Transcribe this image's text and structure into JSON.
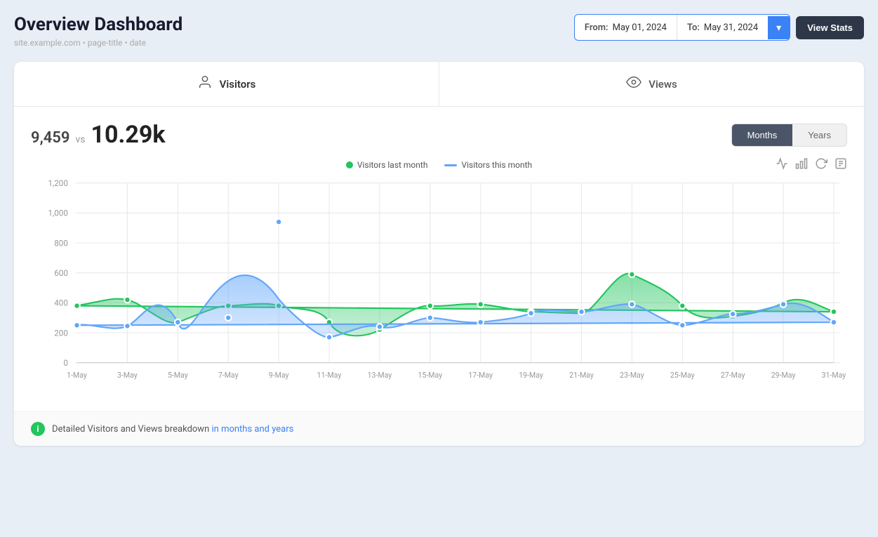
{
  "header": {
    "title": "Overview Dashboard",
    "subtitle": "site.example.com • page-title • date",
    "from_label": "From:",
    "from_date": "May 01, 2024",
    "to_label": "To:",
    "to_date": "May 31, 2024",
    "dropdown_icon": "▾",
    "view_stats_label": "View Stats"
  },
  "tabs": [
    {
      "label": "Visitors",
      "icon": "person",
      "active": true
    },
    {
      "label": "Views",
      "icon": "eye",
      "active": false
    }
  ],
  "stats": {
    "previous": "9,459",
    "vs_label": "vs",
    "current": "10.29k"
  },
  "toggle": {
    "months_label": "Months",
    "years_label": "Years"
  },
  "legend": [
    {
      "label": "Visitors last month",
      "color": "#22c55e",
      "type": "dot"
    },
    {
      "label": "Visitors this month",
      "color": "#60a5fa",
      "type": "square"
    }
  ],
  "chart": {
    "y_labels": [
      "1,200",
      "1,000",
      "800",
      "600",
      "400",
      "200",
      "0"
    ],
    "x_labels": [
      "1-May",
      "3-May",
      "5-May",
      "7-May",
      "9-May",
      "11-May",
      "13-May",
      "15-May",
      "17-May",
      "19-May",
      "21-May",
      "23-May",
      "25-May",
      "27-May",
      "29-May",
      "31-May"
    ]
  },
  "chart_icons": [
    "line-chart-icon",
    "bar-chart-icon",
    "refresh-icon",
    "download-icon"
  ],
  "info": {
    "text": "Detailed Visitors and Views breakdown",
    "link_text": "in months and years"
  }
}
